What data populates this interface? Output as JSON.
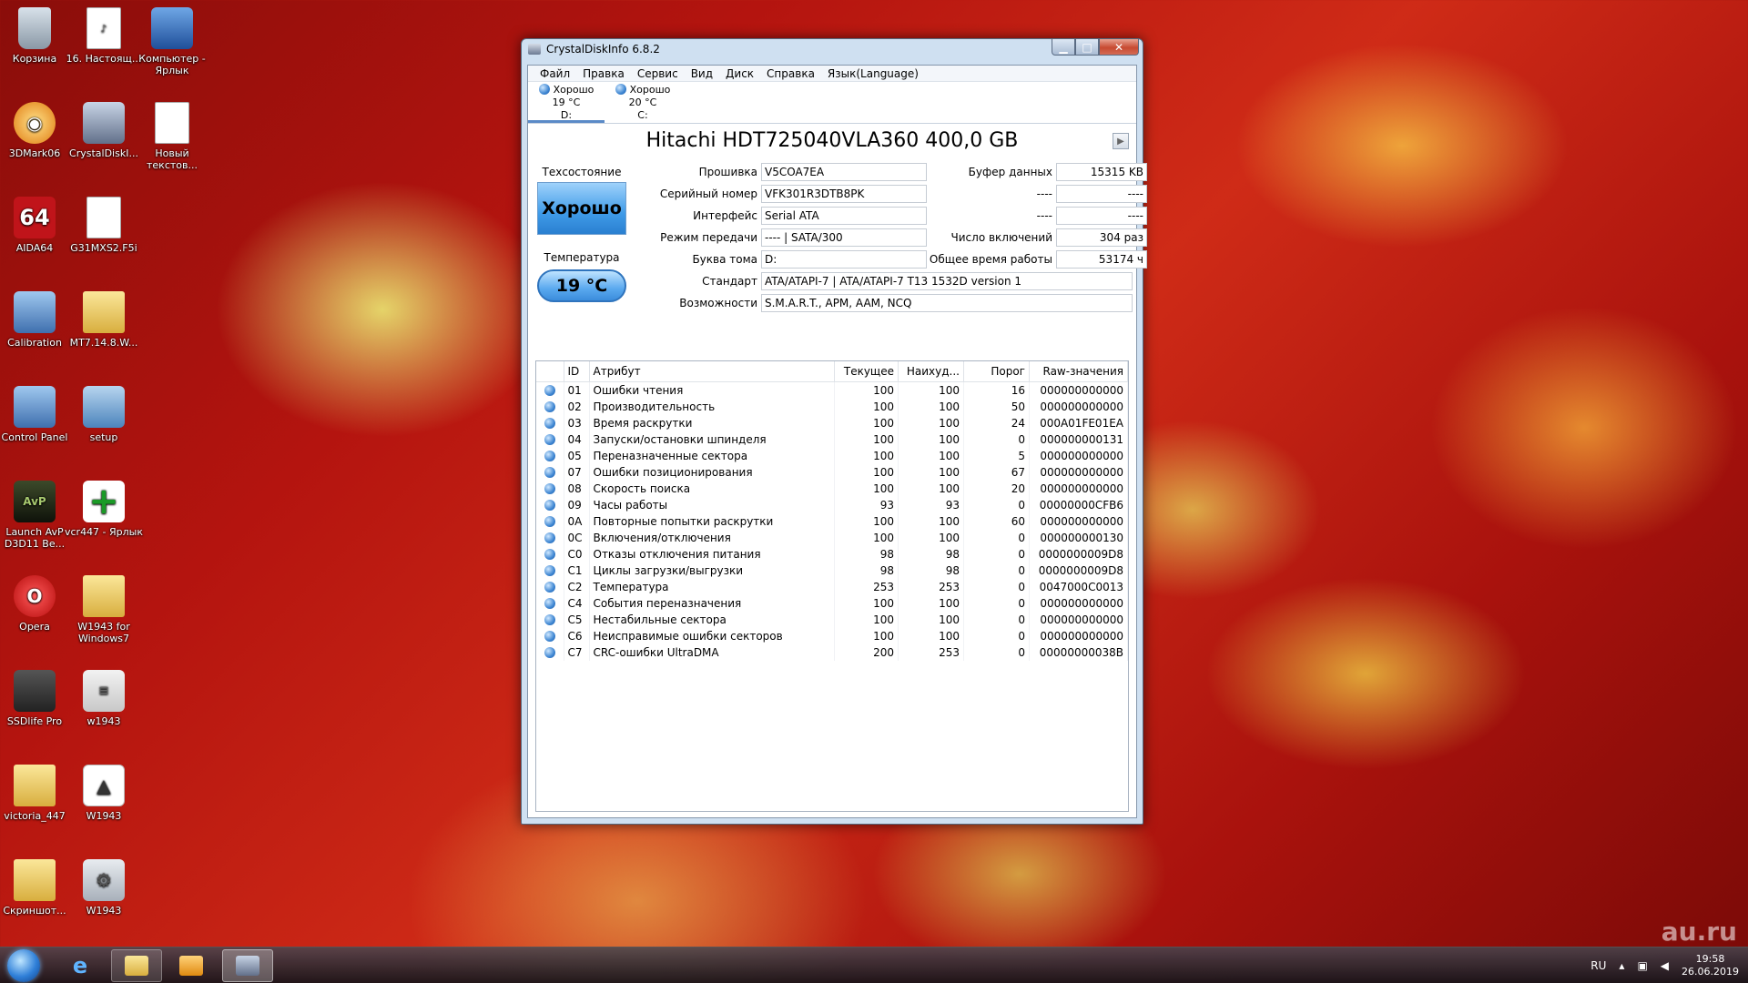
{
  "desktop": {
    "icons": [
      {
        "label": "Корзина",
        "icon": "recycle-bin-icon"
      },
      {
        "label": "16. Настоящ...",
        "icon": "mp3-file-icon"
      },
      {
        "label": "Компьютер - Ярлык",
        "icon": "computer-shortcut-icon"
      },
      {
        "label": "3DMark06",
        "icon": "3dmark-icon"
      },
      {
        "label": "CrystalDiskI...",
        "icon": "crystaldiskinfo-icon"
      },
      {
        "label": "Новый текстов...",
        "icon": "text-file-icon"
      },
      {
        "label": "AIDA64",
        "icon": "aida64-icon"
      },
      {
        "label": "G31MXS2.F5i",
        "icon": "file-icon"
      },
      {
        "label": "Calibration",
        "icon": "calibration-icon"
      },
      {
        "label": "MT7.14.8.W...",
        "icon": "archive-folder-icon"
      },
      {
        "label": "Control Panel",
        "icon": "control-panel-icon"
      },
      {
        "label": "setup",
        "icon": "setup-icon"
      },
      {
        "label": "Launch AvP D3D11 Be...",
        "icon": "avp-game-icon"
      },
      {
        "label": "vcr447 - Ярлык",
        "icon": "plus-shortcut-icon"
      },
      {
        "label": "Opera",
        "icon": "opera-icon"
      },
      {
        "label": "W1943 for Windows7",
        "icon": "folder-icon"
      },
      {
        "label": "SSDlife Pro",
        "icon": "ssdlife-icon"
      },
      {
        "label": "w1943",
        "icon": "document-icon"
      },
      {
        "label": "victoria_447",
        "icon": "folder-icon"
      },
      {
        "label": "W1943",
        "icon": "triangle-app-icon"
      },
      {
        "label": "Скриншот...",
        "icon": "folder-icon"
      },
      {
        "label": "W1943",
        "icon": "settings-file-icon"
      }
    ]
  },
  "window": {
    "title": "CrystalDiskInfo 6.8.2",
    "controls": {
      "minimize": "▁",
      "maximize": "□",
      "close": "✕"
    },
    "menu": [
      "Файл",
      "Правка",
      "Сервис",
      "Вид",
      "Диск",
      "Справка",
      "Язык(Language)"
    ],
    "disks": [
      {
        "status": "Хорошо",
        "temp": "19 °C",
        "letter": "D:",
        "active": true
      },
      {
        "status": "Хорошо",
        "temp": "20 °C",
        "letter": "C:",
        "active": false
      }
    ],
    "model": "Hitachi HDT725040VLA360 400,0 GB",
    "health_label": "Техсостояние",
    "health_value": "Хорошо",
    "temp_label": "Температура",
    "temp_value": "19 °C",
    "fields": {
      "firmware": {
        "label": "Прошивка",
        "value": "V5COA7EA"
      },
      "serial": {
        "label": "Серийный номер",
        "value": "VFK301R3DTB8PK"
      },
      "interface": {
        "label": "Интерфейс",
        "value": "Serial ATA"
      },
      "transfer": {
        "label": "Режим передачи",
        "value": "---- | SATA/300"
      },
      "volume": {
        "label": "Буква тома",
        "value": "D:"
      },
      "standard": {
        "label": "Стандарт",
        "value": "ATA/ATAPI-7 | ATA/ATAPI-7 T13 1532D version 1"
      },
      "features": {
        "label": "Возможности",
        "value": "S.M.A.R.T., APM, AAM, NCQ"
      },
      "buffer": {
        "label": "Буфер данных",
        "value": "15315 KB"
      },
      "blank1": {
        "label": "----",
        "value": "----"
      },
      "blank2": {
        "label": "----",
        "value": "----"
      },
      "power_count": {
        "label": "Число включений",
        "value": "304 раз"
      },
      "power_hours": {
        "label": "Общее время работы",
        "value": "53174 ч"
      }
    },
    "smart": {
      "headers": [
        "ID",
        "Атрибут",
        "Текущее",
        "Наихуд...",
        "Порог",
        "Raw-значения"
      ],
      "rows": [
        [
          "01",
          "Ошибки чтения",
          "100",
          "100",
          "16",
          "000000000000"
        ],
        [
          "02",
          "Производительность",
          "100",
          "100",
          "50",
          "000000000000"
        ],
        [
          "03",
          "Время раскрутки",
          "100",
          "100",
          "24",
          "000A01FE01EA"
        ],
        [
          "04",
          "Запуски/остановки шпинделя",
          "100",
          "100",
          "0",
          "000000000131"
        ],
        [
          "05",
          "Переназначенные сектора",
          "100",
          "100",
          "5",
          "000000000000"
        ],
        [
          "07",
          "Ошибки позиционирования",
          "100",
          "100",
          "67",
          "000000000000"
        ],
        [
          "08",
          "Скорость поиска",
          "100",
          "100",
          "20",
          "000000000000"
        ],
        [
          "09",
          "Часы работы",
          "93",
          "93",
          "0",
          "00000000CFB6"
        ],
        [
          "0A",
          "Повторные попытки раскрутки",
          "100",
          "100",
          "60",
          "000000000000"
        ],
        [
          "0C",
          "Включения/отключения",
          "100",
          "100",
          "0",
          "000000000130"
        ],
        [
          "C0",
          "Отказы отключения питания",
          "98",
          "98",
          "0",
          "0000000009D8"
        ],
        [
          "C1",
          "Циклы загрузки/выгрузки",
          "98",
          "98",
          "0",
          "0000000009D8"
        ],
        [
          "C2",
          "Температура",
          "253",
          "253",
          "0",
          "0047000C0013"
        ],
        [
          "C4",
          "События переназначения",
          "100",
          "100",
          "0",
          "000000000000"
        ],
        [
          "C5",
          "Нестабильные сектора",
          "100",
          "100",
          "0",
          "000000000000"
        ],
        [
          "C6",
          "Неисправимые ошибки секторов",
          "100",
          "100",
          "0",
          "000000000000"
        ],
        [
          "C7",
          "CRC-ошибки UltraDMA",
          "200",
          "253",
          "0",
          "00000000038B"
        ]
      ]
    }
  },
  "taskbar": {
    "language": "RU",
    "time": "19:58",
    "date": "26.06.2019",
    "watermark": "au.ru"
  }
}
